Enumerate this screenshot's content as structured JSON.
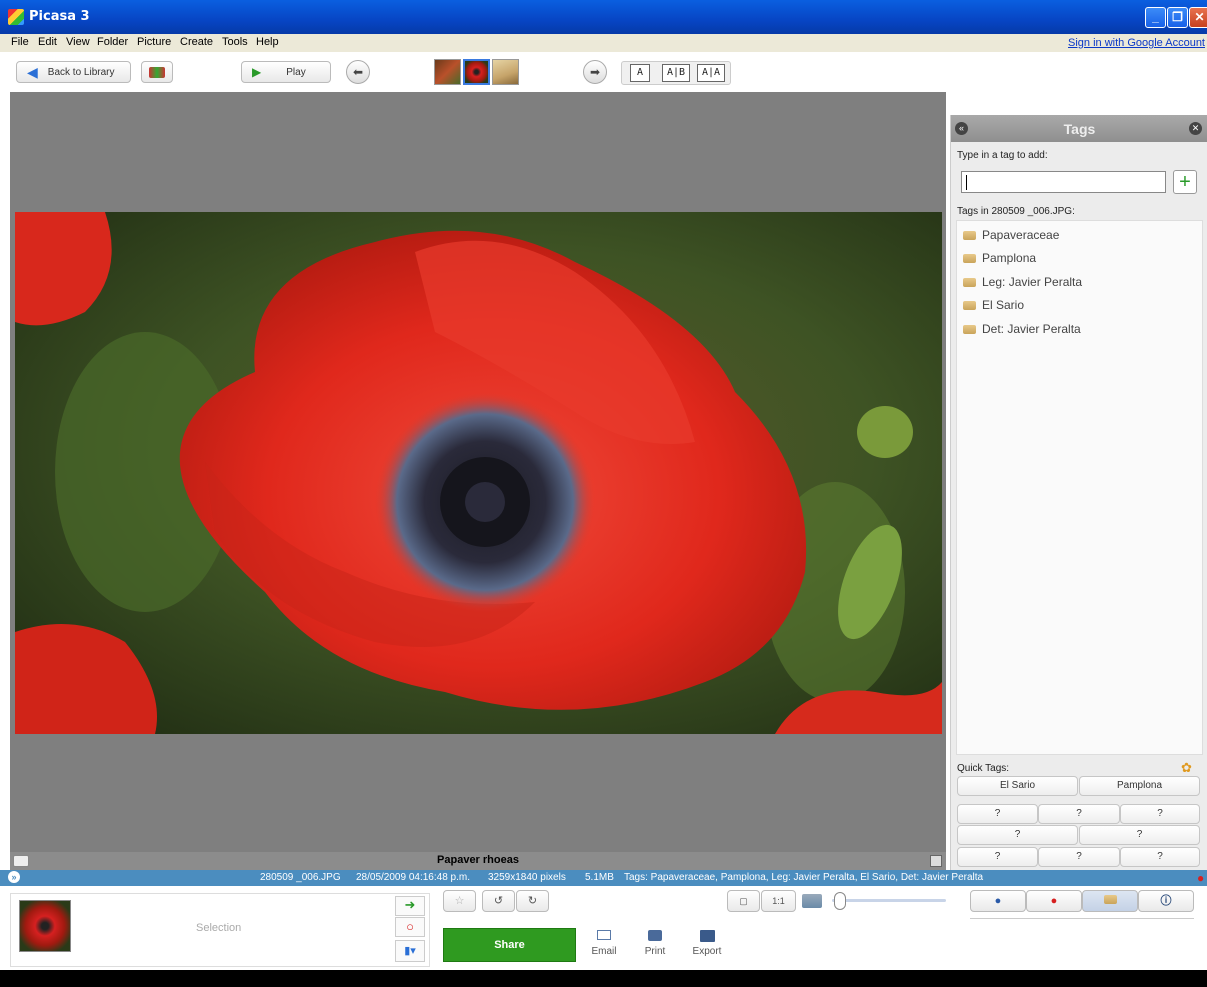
{
  "window": {
    "title": "Picasa 3"
  },
  "menu": [
    "File",
    "Edit",
    "View",
    "Folder",
    "Picture",
    "Create",
    "Tools",
    "Help"
  ],
  "signin": "Sign in with Google Account",
  "toolbar": {
    "back_label": "Back to Library",
    "play_label": "Play",
    "layout_single": "A",
    "layout_compare": "A|B",
    "layout_dual": "A|A"
  },
  "tags_panel": {
    "title": "Tags",
    "input_label": "Type in a tag to add:",
    "input_value": "",
    "list_label": "Tags in 280509 _006.JPG:",
    "tags": [
      "Papaveraceae",
      "Pamplona",
      "Leg: Javier Peralta",
      "El Sario",
      "Det: Javier Peralta"
    ],
    "quick_tags_label": "Quick Tags:",
    "quick_tags": [
      "El Sario",
      "Pamplona",
      "?",
      "?",
      "?",
      "?",
      "?",
      "?",
      "?",
      "?"
    ]
  },
  "caption": "Papaver rhoeas",
  "infobar": {
    "filename": "280509 _006.JPG",
    "date": "28/05/2009 04:16:48 p.m.",
    "dimensions": "3259x1840 pixels",
    "size": "5.1MB",
    "tags": "Tags: Papaveraceae, Pamplona, Leg: Javier Peralta, El Sario, Det: Javier Peralta"
  },
  "tray": {
    "selection_label": "Selection",
    "share_label": "Share",
    "email_label": "Email",
    "print_label": "Print",
    "export_label": "Export"
  },
  "colors": {
    "share_green": "#2f9a20",
    "titlebar_blue": "#0745c4",
    "info_blue": "#4b8dbf"
  }
}
